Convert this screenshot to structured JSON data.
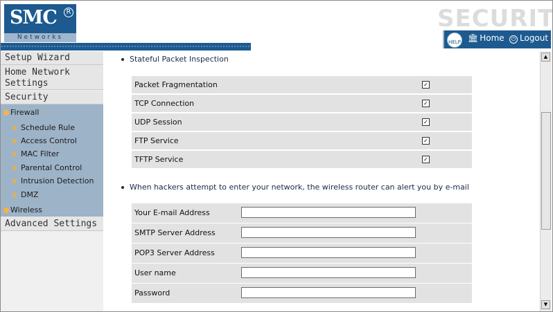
{
  "header": {
    "logo_main": "SMC",
    "logo_reg": "R",
    "logo_sub": "Networks",
    "section_title": "SECURITY",
    "help_label": "HELP",
    "home_label": "Home",
    "logout_label": "Logout"
  },
  "sidebar": {
    "top_items": [
      {
        "label": "Setup Wizard"
      },
      {
        "label": "Home Network Settings"
      },
      {
        "label": "Security"
      },
      {
        "label": "Advanced Settings"
      }
    ],
    "groups": [
      {
        "label": "Firewall"
      },
      {
        "label": "Wireless"
      }
    ],
    "firewall_items": [
      {
        "label": "Schedule Rule"
      },
      {
        "label": "Access Control"
      },
      {
        "label": "MAC Filter"
      },
      {
        "label": "Parental Control"
      },
      {
        "label": "Intrusion Detection"
      },
      {
        "label": "DMZ"
      }
    ]
  },
  "main": {
    "spi_heading": "Stateful Packet Inspection",
    "spi_rows": [
      {
        "label": "Packet Fragmentation",
        "checked": true
      },
      {
        "label": "TCP Connection",
        "checked": true
      },
      {
        "label": "UDP Session",
        "checked": true
      },
      {
        "label": "FTP Service",
        "checked": true
      },
      {
        "label": "TFTP  Service",
        "checked": true
      }
    ],
    "alert_heading": "When hackers attempt to enter your network, the wireless router can alert you by e-mail",
    "alert_fields": [
      {
        "label": "Your E-mail Address",
        "value": ""
      },
      {
        "label": "SMTP Server Address",
        "value": ""
      },
      {
        "label": "POP3 Server Address",
        "value": ""
      },
      {
        "label": "User name",
        "value": ""
      },
      {
        "label": "Password",
        "value": ""
      }
    ]
  },
  "colors": {
    "brand_blue": "#1c5a8f",
    "submenu_bg": "#9db3c8",
    "row_bg": "#e2e2e2",
    "bullet": "#f5b24c"
  },
  "icons": [
    "help-icon",
    "home-icon",
    "logout-icon",
    "orange-bullet-icon",
    "triangle-arrow-icon",
    "checkbox-icon",
    "scroll-up-icon",
    "scroll-down-icon"
  ]
}
